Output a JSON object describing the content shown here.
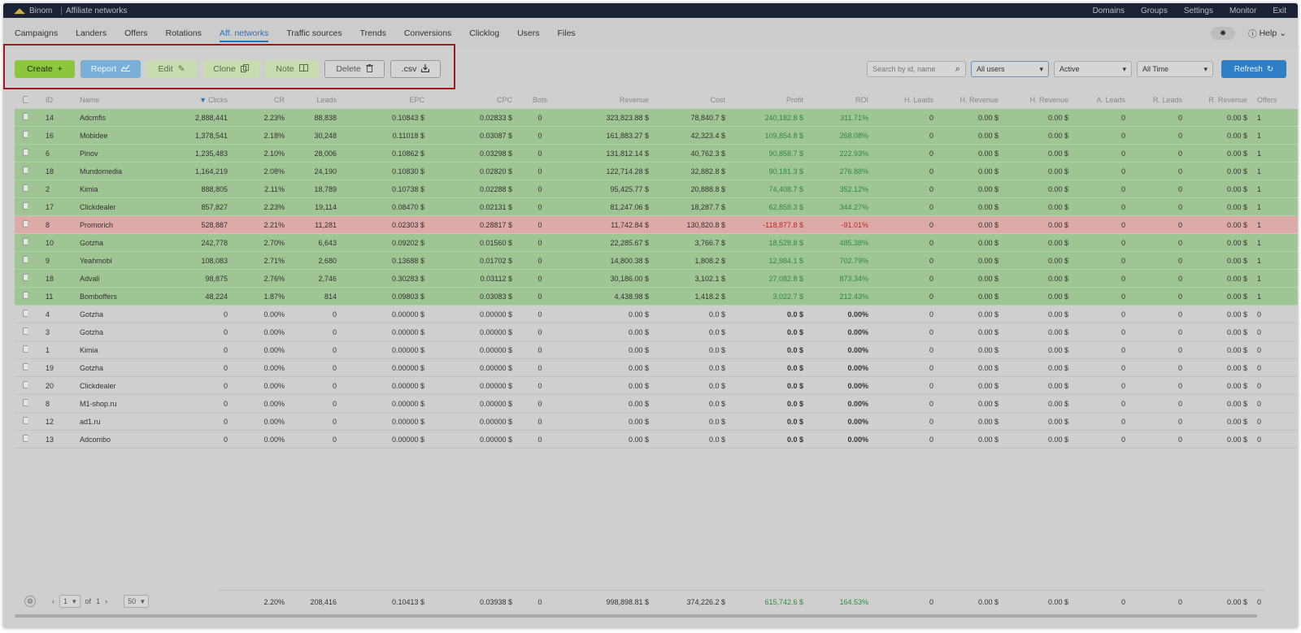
{
  "topbar": {
    "brand": "Binom",
    "page": "Affiliate networks",
    "links": [
      "Domains",
      "Groups",
      "Settings",
      "Monitor",
      "Exit"
    ]
  },
  "nav": {
    "tabs": [
      "Campaigns",
      "Landers",
      "Offers",
      "Rotations",
      "Aff. networks",
      "Traffic sources",
      "Trends",
      "Conversions",
      "Clicklog",
      "Users",
      "Files"
    ],
    "active_index": 4,
    "help": "Help"
  },
  "toolbar": {
    "create": "Create",
    "report": "Report",
    "edit": "Edit",
    "clone": "Clone",
    "note": "Note",
    "delete": "Delete",
    "csv": ".csv",
    "search_placeholder": "Search by id, name",
    "users_select": "All users",
    "status_select": "Active",
    "time_select": "All Time",
    "refresh": "Refresh"
  },
  "colors": {
    "positive_row": "#9fc595",
    "negative_row": "#dcaaa7",
    "highlight_border": "#9a1c1c",
    "accent": "#2b71c2"
  },
  "table": {
    "headers": [
      "ID",
      "Name",
      "Clicks",
      "CR",
      "Leads",
      "EPC",
      "CPC",
      "Bots",
      "Revenue",
      "Cost",
      "Profit",
      "ROI",
      "H. Leads",
      "H. Revenue",
      "H. Revenue",
      "A. Leads",
      "R. Leads",
      "R. Revenue",
      "Offers"
    ],
    "rows": [
      {
        "status": "pos",
        "id": "14",
        "name": "Adcmfis",
        "clicks": "2,888,441",
        "cr": "2.23%",
        "leads": "88,838",
        "epc": "0.10843 $",
        "cpc": "0.02833 $",
        "bots": "0",
        "revenue": "323,823.88 $",
        "cost": "78,840.7 $",
        "profit": "240,182.8 $",
        "roi": "311.71%",
        "hleads": "0",
        "hrev1": "0.00 $",
        "hrev2": "0.00 $",
        "aleads": "0",
        "rleads": "0",
        "rrev": "0.00 $",
        "offers": "1"
      },
      {
        "status": "pos",
        "id": "16",
        "name": "Mobidee",
        "clicks": "1,378,541",
        "cr": "2.18%",
        "leads": "30,248",
        "epc": "0.11018 $",
        "cpc": "0.03087 $",
        "bots": "0",
        "revenue": "161,883.27 $",
        "cost": "42,323.4 $",
        "profit": "109,854.8 $",
        "roi": "268.08%",
        "hleads": "0",
        "hrev1": "0.00 $",
        "hrev2": "0.00 $",
        "aleads": "0",
        "rleads": "0",
        "rrev": "0.00 $",
        "offers": "1"
      },
      {
        "status": "pos",
        "id": "6",
        "name": "Pinov",
        "clicks": "1,235,483",
        "cr": "2.10%",
        "leads": "28,006",
        "epc": "0.10862 $",
        "cpc": "0.03298 $",
        "bots": "0",
        "revenue": "131,812.14 $",
        "cost": "40,762.3 $",
        "profit": "90,858.7 $",
        "roi": "222.93%",
        "hleads": "0",
        "hrev1": "0.00 $",
        "hrev2": "0.00 $",
        "aleads": "0",
        "rleads": "0",
        "rrev": "0.00 $",
        "offers": "1"
      },
      {
        "status": "pos",
        "id": "18",
        "name": "Mundomedia",
        "clicks": "1,164,219",
        "cr": "2.08%",
        "leads": "24,190",
        "epc": "0.10830 $",
        "cpc": "0.02820 $",
        "bots": "0",
        "revenue": "122,714.28 $",
        "cost": "32,882.8 $",
        "profit": "90,181.3 $",
        "roi": "276.88%",
        "hleads": "0",
        "hrev1": "0.00 $",
        "hrev2": "0.00 $",
        "aleads": "0",
        "rleads": "0",
        "rrev": "0.00 $",
        "offers": "1"
      },
      {
        "status": "pos",
        "id": "2",
        "name": "Kimia",
        "clicks": "888,805",
        "cr": "2.11%",
        "leads": "18,789",
        "epc": "0.10738 $",
        "cpc": "0.02288 $",
        "bots": "0",
        "revenue": "95,425.77 $",
        "cost": "20,888.8 $",
        "profit": "74,408.7 $",
        "roi": "352.12%",
        "hleads": "0",
        "hrev1": "0.00 $",
        "hrev2": "0.00 $",
        "aleads": "0",
        "rleads": "0",
        "rrev": "0.00 $",
        "offers": "1"
      },
      {
        "status": "pos",
        "id": "17",
        "name": "Clickdealer",
        "clicks": "857,827",
        "cr": "2.23%",
        "leads": "19,114",
        "epc": "0.08470 $",
        "cpc": "0.02131 $",
        "bots": "0",
        "revenue": "81,247.06 $",
        "cost": "18,287.7 $",
        "profit": "62,858.3 $",
        "roi": "344.27%",
        "hleads": "0",
        "hrev1": "0.00 $",
        "hrev2": "0.00 $",
        "aleads": "0",
        "rleads": "0",
        "rrev": "0.00 $",
        "offers": "1"
      },
      {
        "status": "neg",
        "id": "8",
        "name": "Promorich",
        "clicks": "528,887",
        "cr": "2.21%",
        "leads": "11,281",
        "epc": "0.02303 $",
        "cpc": "0.28817 $",
        "bots": "0",
        "revenue": "11,742.84 $",
        "cost": "130,820.8 $",
        "profit": "-118,877.8 $",
        "roi": "-91.01%",
        "hleads": "0",
        "hrev1": "0.00 $",
        "hrev2": "0.00 $",
        "aleads": "0",
        "rleads": "0",
        "rrev": "0.00 $",
        "offers": "1"
      },
      {
        "status": "pos",
        "id": "10",
        "name": "Gotzha",
        "clicks": "242,778",
        "cr": "2.70%",
        "leads": "6,643",
        "epc": "0.09202 $",
        "cpc": "0.01560 $",
        "bots": "0",
        "revenue": "22,285.67 $",
        "cost": "3,766.7 $",
        "profit": "18,528.8 $",
        "roi": "485.38%",
        "hleads": "0",
        "hrev1": "0.00 $",
        "hrev2": "0.00 $",
        "aleads": "0",
        "rleads": "0",
        "rrev": "0.00 $",
        "offers": "1"
      },
      {
        "status": "pos",
        "id": "9",
        "name": "Yeahmobi",
        "clicks": "108,083",
        "cr": "2.71%",
        "leads": "2,680",
        "epc": "0.13688 $",
        "cpc": "0.01702 $",
        "bots": "0",
        "revenue": "14,800.38 $",
        "cost": "1,808.2 $",
        "profit": "12,984.1 $",
        "roi": "702.79%",
        "hleads": "0",
        "hrev1": "0.00 $",
        "hrev2": "0.00 $",
        "aleads": "0",
        "rleads": "0",
        "rrev": "0.00 $",
        "offers": "1"
      },
      {
        "status": "pos",
        "id": "18",
        "name": "Advali",
        "clicks": "98,875",
        "cr": "2.76%",
        "leads": "2,746",
        "epc": "0.30283 $",
        "cpc": "0.03112 $",
        "bots": "0",
        "revenue": "30,186.00 $",
        "cost": "3,102.1 $",
        "profit": "27,082.8 $",
        "roi": "873.34%",
        "hleads": "0",
        "hrev1": "0.00 $",
        "hrev2": "0.00 $",
        "aleads": "0",
        "rleads": "0",
        "rrev": "0.00 $",
        "offers": "1"
      },
      {
        "status": "pos",
        "id": "11",
        "name": "Bomboffers",
        "clicks": "48,224",
        "cr": "1.87%",
        "leads": "814",
        "epc": "0.09803 $",
        "cpc": "0.03083 $",
        "bots": "0",
        "revenue": "4,438.98 $",
        "cost": "1,418.2 $",
        "profit": "3,022.7 $",
        "roi": "212.43%",
        "hleads": "0",
        "hrev1": "0.00 $",
        "hrev2": "0.00 $",
        "aleads": "0",
        "rleads": "0",
        "rrev": "0.00 $",
        "offers": "1"
      },
      {
        "status": "zero",
        "id": "4",
        "name": "Gotzha",
        "clicks": "0",
        "cr": "0.00%",
        "leads": "0",
        "epc": "0.00000 $",
        "cpc": "0.00000 $",
        "bots": "0",
        "revenue": "0.00 $",
        "cost": "0.0 $",
        "profit": "0.0 $",
        "roi": "0.00%",
        "hleads": "0",
        "hrev1": "0.00 $",
        "hrev2": "0.00 $",
        "aleads": "0",
        "rleads": "0",
        "rrev": "0.00 $",
        "offers": "0"
      },
      {
        "status": "zero",
        "id": "3",
        "name": "Gotzha",
        "clicks": "0",
        "cr": "0.00%",
        "leads": "0",
        "epc": "0.00000 $",
        "cpc": "0.00000 $",
        "bots": "0",
        "revenue": "0.00 $",
        "cost": "0.0 $",
        "profit": "0.0 $",
        "roi": "0.00%",
        "hleads": "0",
        "hrev1": "0.00 $",
        "hrev2": "0.00 $",
        "aleads": "0",
        "rleads": "0",
        "rrev": "0.00 $",
        "offers": "0"
      },
      {
        "status": "zero",
        "id": "1",
        "name": "Kimia",
        "clicks": "0",
        "cr": "0.00%",
        "leads": "0",
        "epc": "0.00000 $",
        "cpc": "0.00000 $",
        "bots": "0",
        "revenue": "0.00 $",
        "cost": "0.0 $",
        "profit": "0.0 $",
        "roi": "0.00%",
        "hleads": "0",
        "hrev1": "0.00 $",
        "hrev2": "0.00 $",
        "aleads": "0",
        "rleads": "0",
        "rrev": "0.00 $",
        "offers": "0"
      },
      {
        "status": "zero",
        "id": "19",
        "name": "Gotzha",
        "clicks": "0",
        "cr": "0.00%",
        "leads": "0",
        "epc": "0.00000 $",
        "cpc": "0.00000 $",
        "bots": "0",
        "revenue": "0.00 $",
        "cost": "0.0 $",
        "profit": "0.0 $",
        "roi": "0.00%",
        "hleads": "0",
        "hrev1": "0.00 $",
        "hrev2": "0.00 $",
        "aleads": "0",
        "rleads": "0",
        "rrev": "0.00 $",
        "offers": "0"
      },
      {
        "status": "zero",
        "id": "20",
        "name": "Clickdealer",
        "clicks": "0",
        "cr": "0.00%",
        "leads": "0",
        "epc": "0.00000 $",
        "cpc": "0.00000 $",
        "bots": "0",
        "revenue": "0.00 $",
        "cost": "0.0 $",
        "profit": "0.0 $",
        "roi": "0.00%",
        "hleads": "0",
        "hrev1": "0.00 $",
        "hrev2": "0.00 $",
        "aleads": "0",
        "rleads": "0",
        "rrev": "0.00 $",
        "offers": "0"
      },
      {
        "status": "zero",
        "id": "8",
        "name": "M1-shop.ru",
        "clicks": "0",
        "cr": "0.00%",
        "leads": "0",
        "epc": "0.00000 $",
        "cpc": "0.00000 $",
        "bots": "0",
        "revenue": "0.00 $",
        "cost": "0.0 $",
        "profit": "0.0 $",
        "roi": "0.00%",
        "hleads": "0",
        "hrev1": "0.00 $",
        "hrev2": "0.00 $",
        "aleads": "0",
        "rleads": "0",
        "rrev": "0.00 $",
        "offers": "0"
      },
      {
        "status": "zero",
        "id": "12",
        "name": "ad1.ru",
        "clicks": "0",
        "cr": "0.00%",
        "leads": "0",
        "epc": "0.00000 $",
        "cpc": "0.00000 $",
        "bots": "0",
        "revenue": "0.00 $",
        "cost": "0.0 $",
        "profit": "0.0 $",
        "roi": "0.00%",
        "hleads": "0",
        "hrev1": "0.00 $",
        "hrev2": "0.00 $",
        "aleads": "0",
        "rleads": "0",
        "rrev": "0.00 $",
        "offers": "0"
      },
      {
        "status": "zero",
        "id": "13",
        "name": "Adcombo",
        "clicks": "0",
        "cr": "0.00%",
        "leads": "0",
        "epc": "0.00000 $",
        "cpc": "0.00000 $",
        "bots": "0",
        "revenue": "0.00 $",
        "cost": "0.0 $",
        "profit": "0.0 $",
        "roi": "0.00%",
        "hleads": "0",
        "hrev1": "0.00 $",
        "hrev2": "0.00 $",
        "aleads": "0",
        "rleads": "0",
        "rrev": "0.00 $",
        "offers": "0"
      }
    ]
  },
  "footer": {
    "page": "1",
    "of_label": "of",
    "total_pages": "1",
    "per_page": "50",
    "cr": "2.20%",
    "leads": "208,416",
    "epc": "0.10413 $",
    "cpc": "0.03938 $",
    "bots": "0",
    "revenue": "998,898.81 $",
    "cost": "374,226.2 $",
    "profit": "615,742.6 $",
    "roi": "164.53%",
    "hleads": "0",
    "hrev1": "0.00 $",
    "hrev2": "0.00 $",
    "aleads": "0",
    "rleads": "0",
    "rrev": "0.00 $",
    "offers": "0"
  }
}
